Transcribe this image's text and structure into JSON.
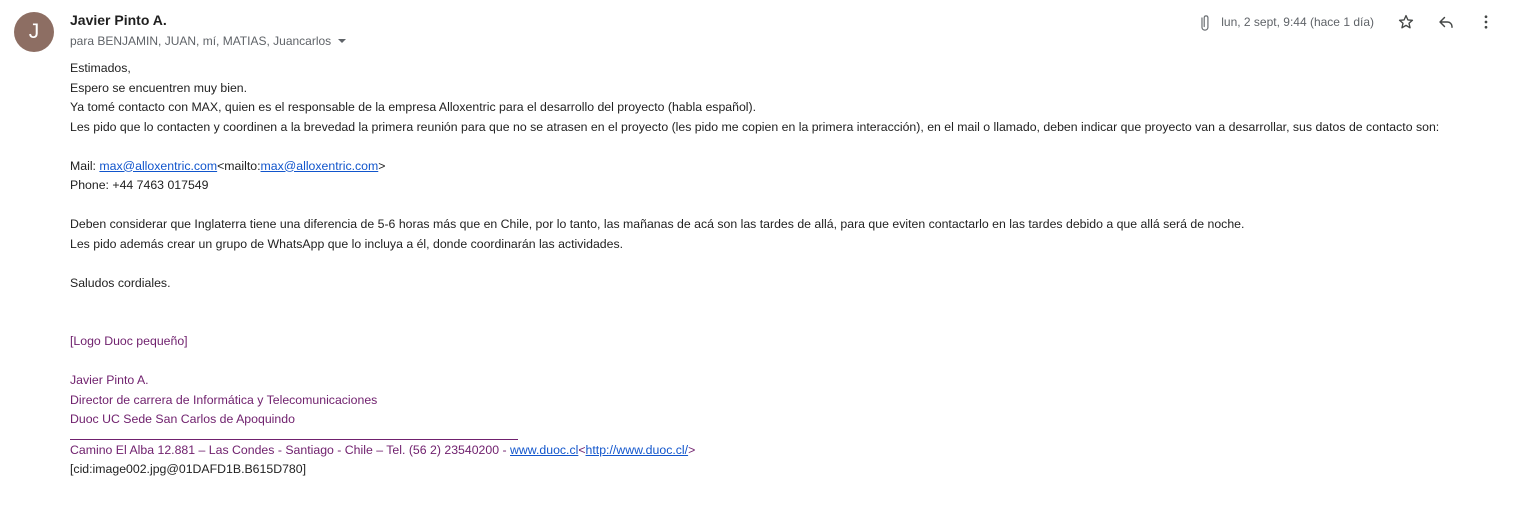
{
  "email": {
    "avatar_letter": "J",
    "sender": "Javier Pinto A.",
    "recipients": "para BENJAMIN, JUAN, mí, MATIAS, Juancarlos",
    "date": "lun, 2 sept, 9:44 (hace 1 día)",
    "body": {
      "greeting": "Estimados,",
      "line1": "Espero se encuentren muy bien.",
      "line2": "Ya tomé contacto con MAX, quien es el responsable de la empresa Alloxentric para el desarrollo del proyecto (habla español).",
      "line3": "Les pido que lo contacten y coordinen a la brevedad la primera reunión para que no se atrasen en el proyecto (les pido me copien en la primera interacción), en el mail o llamado, deben indicar que proyecto van a desarrollar, sus datos de contacto son:",
      "mail_prefix": "Mail: ",
      "mail_link": "max@alloxentric.com",
      "mailto_prefix": "<mailto:",
      "mailto_link": "max@alloxentric.com",
      "mailto_suffix": ">",
      "phone": "Phone: +44 7463 017549",
      "line4": "Deben considerar que Inglaterra tiene una diferencia de 5-6 horas más que en Chile, por lo tanto, las mañanas de acá son las tardes de allá, para que eviten contactarlo en las tardes debido a que allá será de noche.",
      "line5": "Les pido además crear un grupo de WhatsApp que lo incluya a él, donde coordinarán las actividades.",
      "closing": "Saludos cordiales."
    },
    "signature": {
      "logo_alt": "[Logo Duoc pequeño]",
      "name": "Javier Pinto A.",
      "title": "Director de carrera de Informática y Telecomunicaciones",
      "org": "Duoc UC Sede San Carlos de Apoquindo",
      "address": "Camino El Alba 12.881 – Las Condes - Santiago - Chile – Tel. (56 2) 23540200 - ",
      "site_link": "www.duoc.cl",
      "site_prefix": "<",
      "site_url": "http://www.duoc.cl/",
      "site_suffix": ">",
      "cid": "[cid:image002.jpg@01DAFD1B.B615D780]"
    }
  },
  "icons": {
    "attachment": "paperclip-icon",
    "star": "star-icon",
    "reply": "reply-icon",
    "more": "more-vert-icon",
    "expand": "chevron-down-icon"
  }
}
